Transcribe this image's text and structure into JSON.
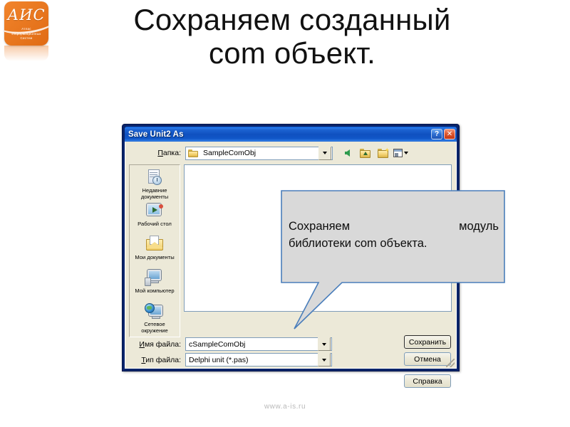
{
  "slide": {
    "title_line1": "Сохраняем созданный",
    "title_line2": "com объект.",
    "footer": "www.a-is.ru"
  },
  "logo": {
    "mark": "АИС",
    "sub_line1": "Атлас",
    "sub_line2": "Информационных",
    "sub_line3": "Систем",
    "color": "#ea7a22"
  },
  "dialog": {
    "title": "Save Unit2 As",
    "help_button": "?",
    "close_button": "✕",
    "lookin": {
      "label": "Папка:",
      "value": "SampleComObj"
    },
    "toolbar": {
      "back": "back-arrow",
      "up": "up-one-level",
      "new_folder": "create-new-folder",
      "views": "views-menu"
    },
    "places": [
      {
        "label_line1": "Недавние",
        "label_line2": "документы",
        "icon": "recent-documents-icon"
      },
      {
        "label_line1": "Рабочий стол",
        "label_line2": "",
        "icon": "desktop-icon"
      },
      {
        "label_line1": "Мои документы",
        "label_line2": "",
        "icon": "my-documents-icon"
      },
      {
        "label_line1": "Мой компьютер",
        "label_line2": "",
        "icon": "my-computer-icon"
      },
      {
        "label_line1": "Сетевое",
        "label_line2": "окружение",
        "icon": "network-places-icon"
      }
    ],
    "file_name": {
      "label": "Имя файла:",
      "value": "cSampleComObj"
    },
    "file_type": {
      "label": "Тип файла:",
      "value": "Delphi unit (*.pas)"
    },
    "buttons": {
      "save": "Сохранить",
      "cancel": "Отмена",
      "help": "Справка"
    },
    "title_bar_color": "#1157c8"
  },
  "callout": {
    "line1_left": "Сохраняем",
    "line1_right": "модуль",
    "line2": "библиотеки com объекта.",
    "border_color": "#4a7ebb",
    "fill_color": "#d9d9d9"
  }
}
